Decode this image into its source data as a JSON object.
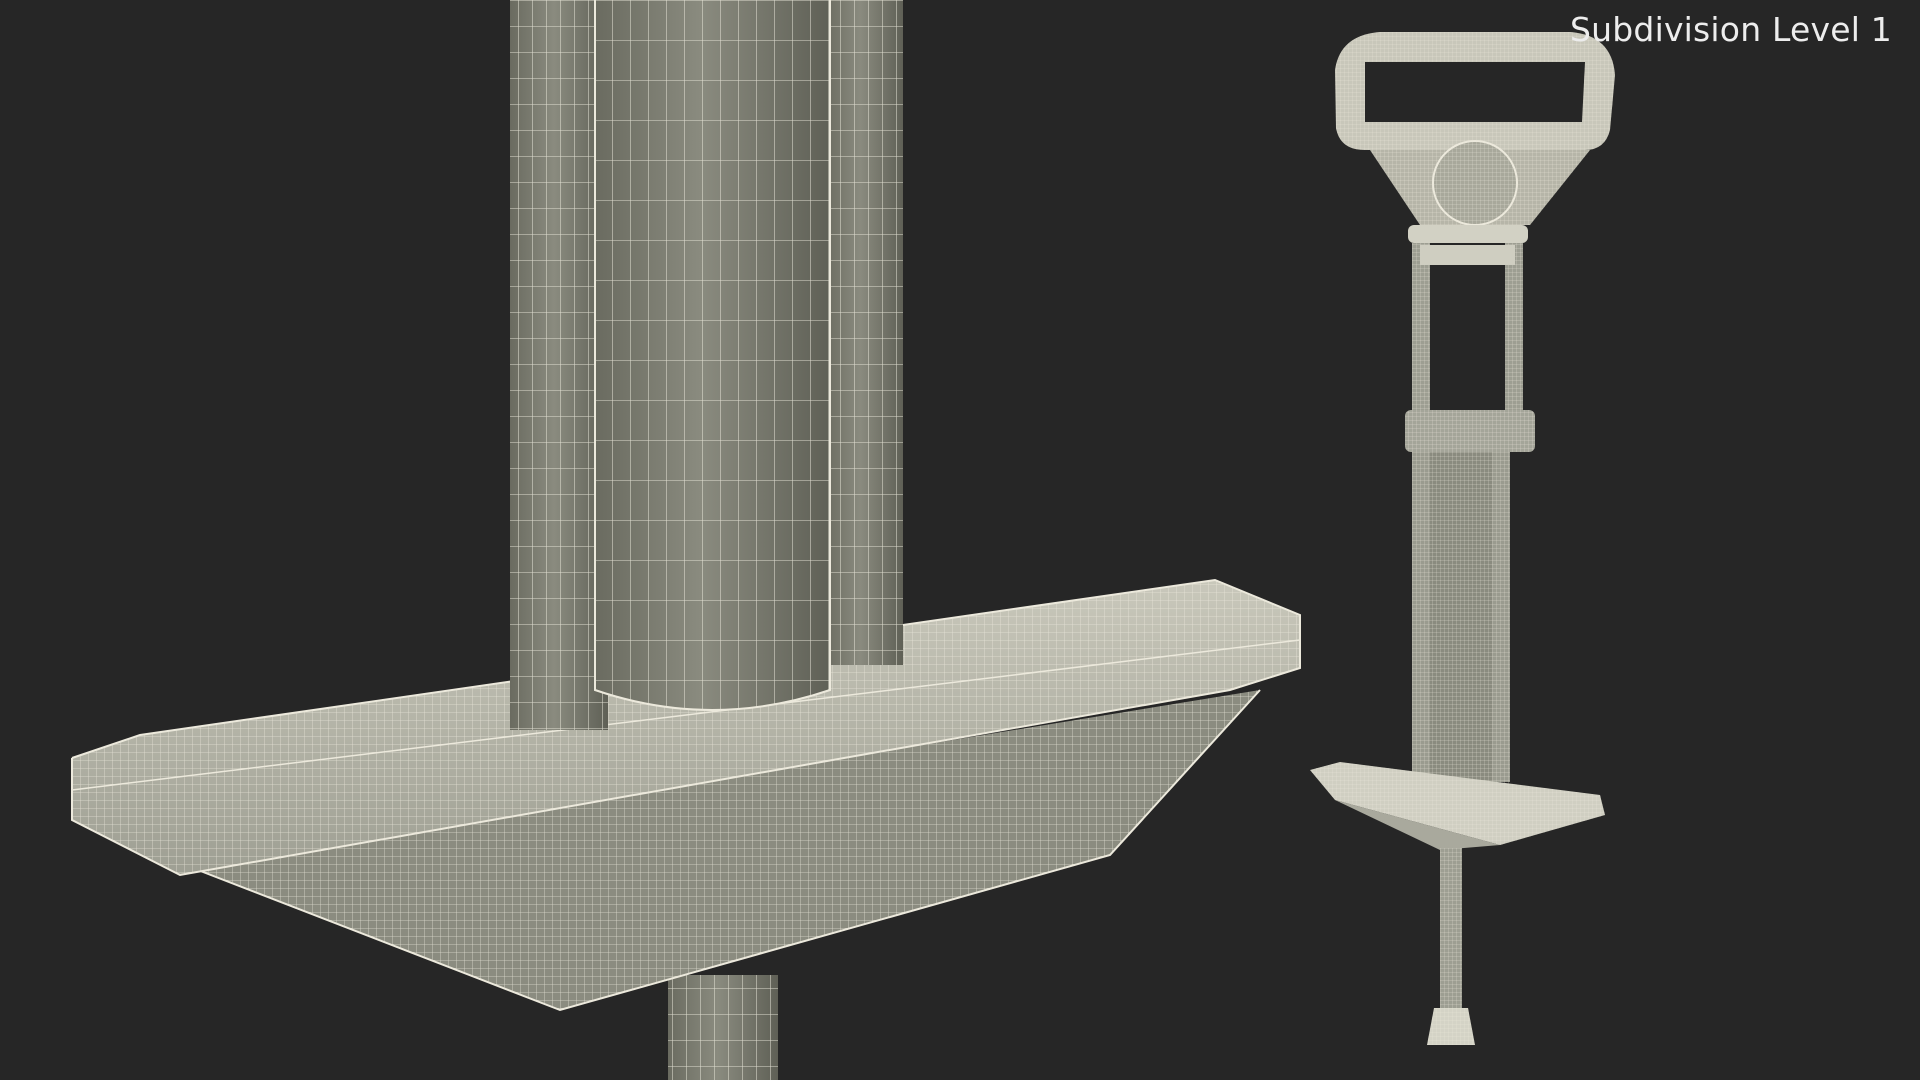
{
  "caption": "Subdivision Level 1",
  "colors": {
    "background": "#262626",
    "surface": "#7d7e72",
    "surface_light": "#a3a498",
    "wire": "#ece9dc"
  },
  "render": {
    "mode": "wireframe",
    "subdivision_level": 1,
    "subject": "pogo-stick"
  }
}
